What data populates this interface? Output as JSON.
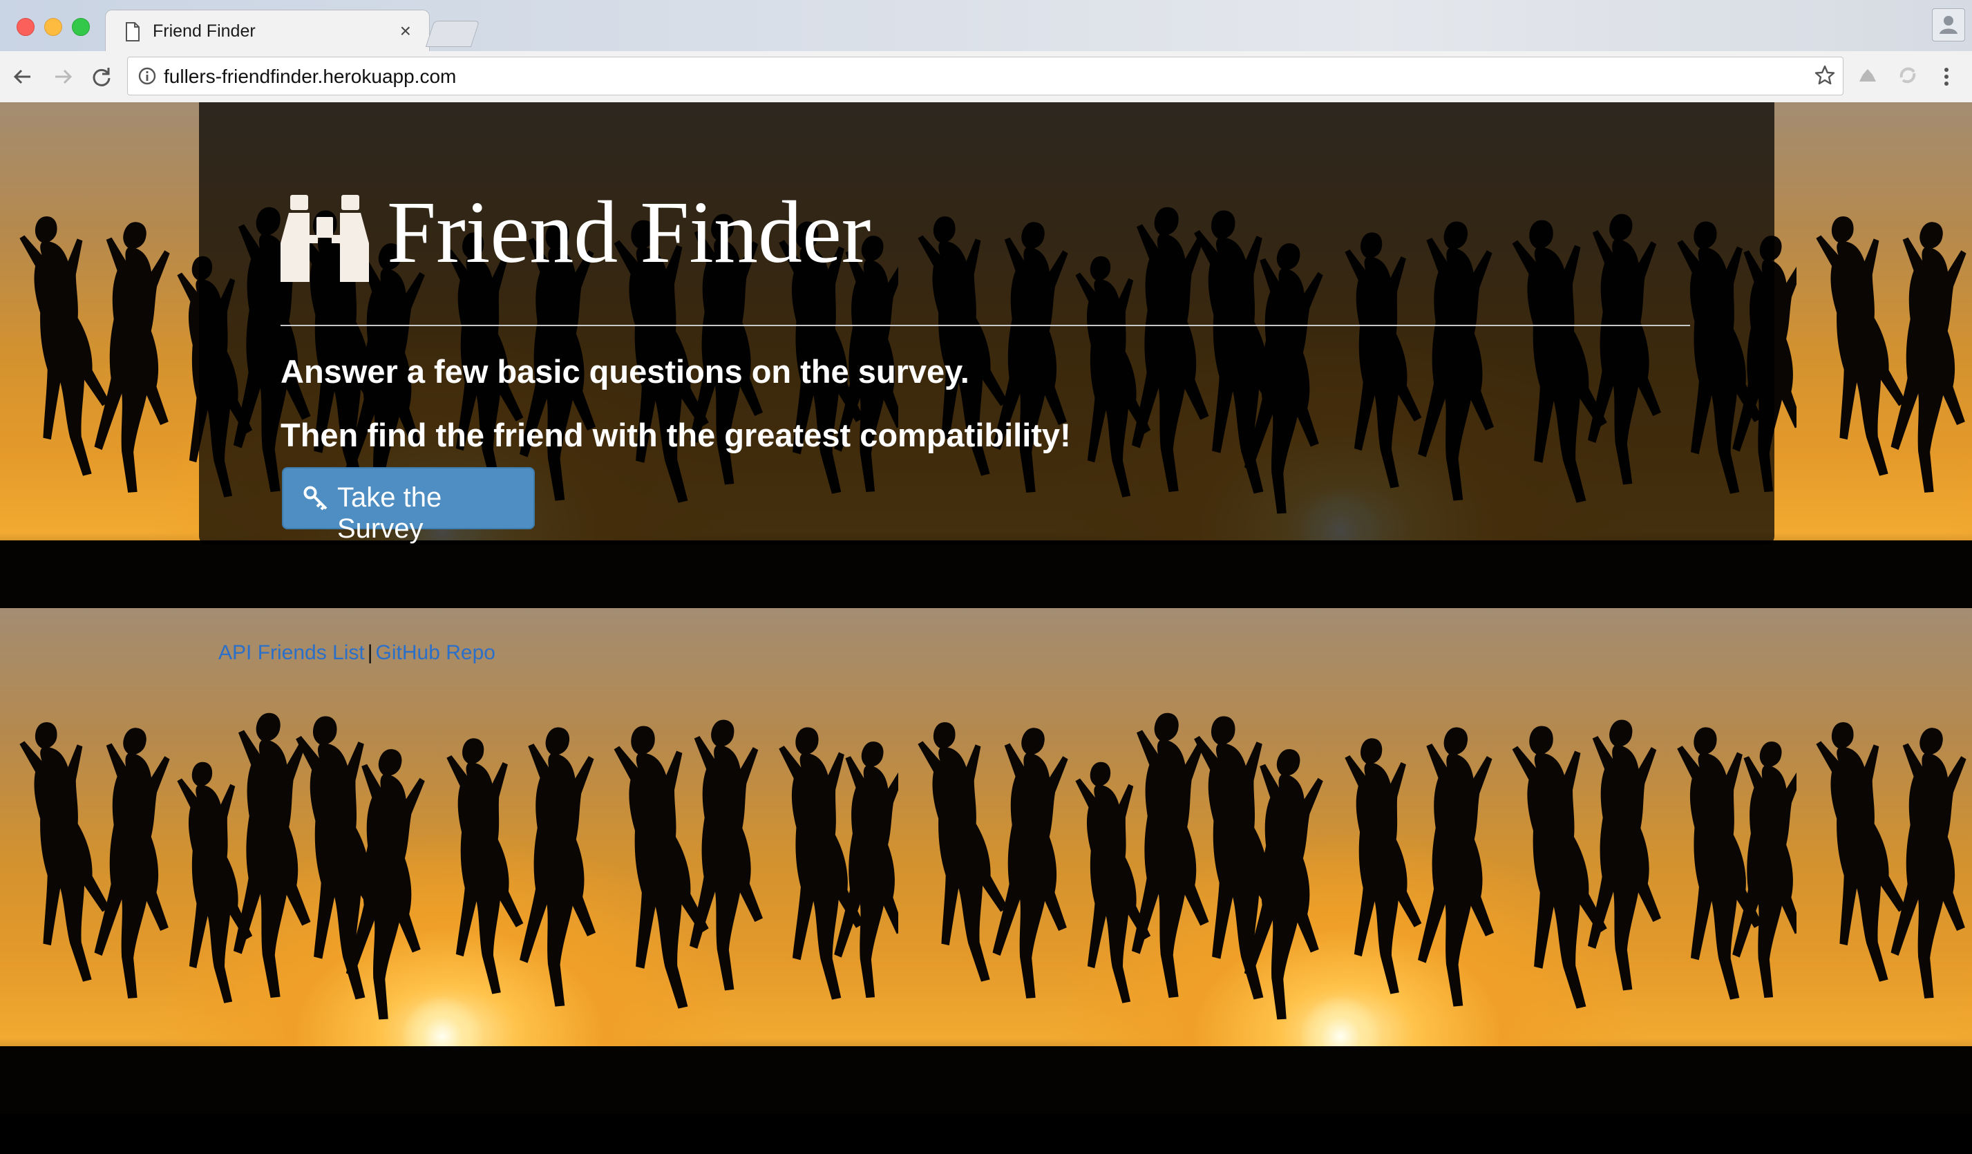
{
  "browser": {
    "tab_title": "Friend Finder",
    "tab_close": "×",
    "url": "fullers-friendfinder.herokuapp.com"
  },
  "hero": {
    "brand": "Friend Finder",
    "line1": "Answer a few basic questions on the survey.",
    "line2": "Then find the friend with the greatest compatibility!",
    "button_label": "Take the Survey"
  },
  "footer": {
    "link_api": "API Friends List",
    "separator": "|",
    "link_github": "GitHub Repo"
  },
  "icons": {
    "tab": "document-icon",
    "back": "back-arrow-icon",
    "forward": "forward-arrow-icon",
    "reload": "reload-icon",
    "site_info": "info-icon",
    "bookmark": "star-icon",
    "brand": "binoculars-icon",
    "button": "key-icon"
  },
  "colors": {
    "button": "#4f8ec2",
    "link": "#2a6fc9",
    "jumbotron": "rgba(0,0,0,0.72)"
  }
}
